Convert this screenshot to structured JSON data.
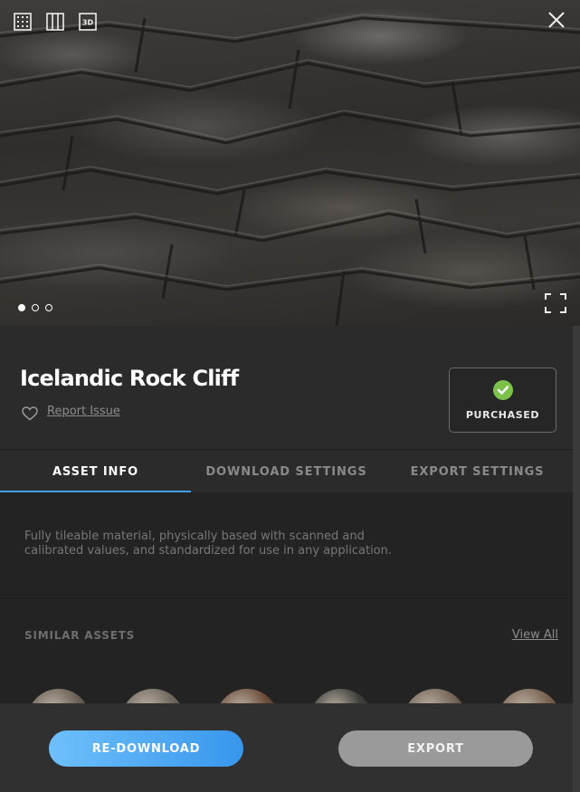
{
  "asset": {
    "title": "Icelandic Rock Cliff",
    "report_label": "Report Issue",
    "status_label": "PURCHASED"
  },
  "preview": {
    "view_modes": [
      {
        "icon": "grid-view-icon"
      },
      {
        "icon": "columns-view-icon"
      },
      {
        "icon": "3d-view-icon",
        "label": "3D"
      }
    ],
    "dots": [
      true,
      false,
      false
    ]
  },
  "tabs": [
    {
      "label": "ASSET INFO",
      "active": true
    },
    {
      "label": "DOWNLOAD SETTINGS",
      "active": false
    },
    {
      "label": "EXPORT SETTINGS",
      "active": false
    }
  ],
  "description": "Fully tileable material, physically based with scanned and calibrated values, and standardized for use in any application.",
  "similar": {
    "title": "SIMILAR ASSETS",
    "view_all": "View All",
    "thumb_colors": [
      "#6c6157",
      "#736a5f",
      "#6d4d3a",
      "#3d3e3a",
      "#756657",
      "#7a6452"
    ]
  },
  "actions": {
    "redownload": "RE-DOWNLOAD",
    "export": "EXPORT"
  },
  "colors": {
    "accent": "#3f9fe6",
    "success": "#7cc24a"
  }
}
